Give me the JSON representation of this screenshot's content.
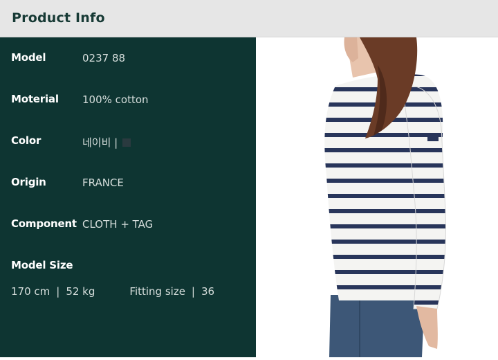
{
  "header": {
    "title": "Product Info"
  },
  "info": {
    "model_label": "Model",
    "model_value": "0237 88",
    "material_label": "Moterial",
    "material_value": "100% cotton",
    "color_label": "Color",
    "color_value": "네이비 |",
    "color_swatch": "#2a3a3f",
    "origin_label": "Origin",
    "origin_value": "FRANCE",
    "component_label": "Component",
    "component_value": "CLOTH + TAG"
  },
  "model_size": {
    "label": "Model Size",
    "height": "170 cm",
    "sep1": "|",
    "weight": "52 kg",
    "fitting_label": "Fitting size",
    "sep2": "|",
    "fitting_value": "36"
  },
  "colors": {
    "header_bg": "#e6e6e6",
    "panel_bg": "#0e3532",
    "stripe_navy": "#28355a"
  }
}
